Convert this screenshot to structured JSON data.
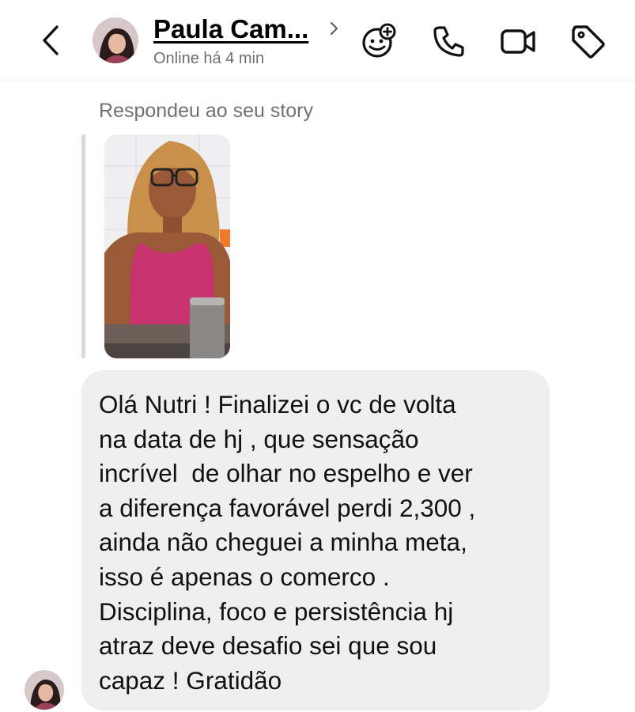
{
  "header": {
    "contact_name": "Paula Cam...",
    "status": "Online há 4 min",
    "icons": [
      "back-chevron-icon",
      "chevron-right-icon",
      "sticker-add-icon",
      "phone-icon",
      "video-camera-icon",
      "tag-icon"
    ]
  },
  "thread": {
    "story_reply_label": "Respondeu ao seu story",
    "message": {
      "lines": [
        "Olá Nutri ! Finalizei o vc de volta",
        "na data de hj , que sensação",
        "incrível  de olhar no espelho e ver",
        "a diferença favorável perdi 2,300 ,",
        "ainda não cheguei a minha meta,",
        "isso é apenas o comerco .",
        "Disciplina, foco e persistência hj",
        "atraz deve desafio sei que sou",
        "capaz ! Gratidão"
      ]
    }
  },
  "colors": {
    "bubble_bg": "#efefef",
    "muted_text": "#717171",
    "story_top": "#c8a8b0",
    "dress": "#c8326e"
  }
}
